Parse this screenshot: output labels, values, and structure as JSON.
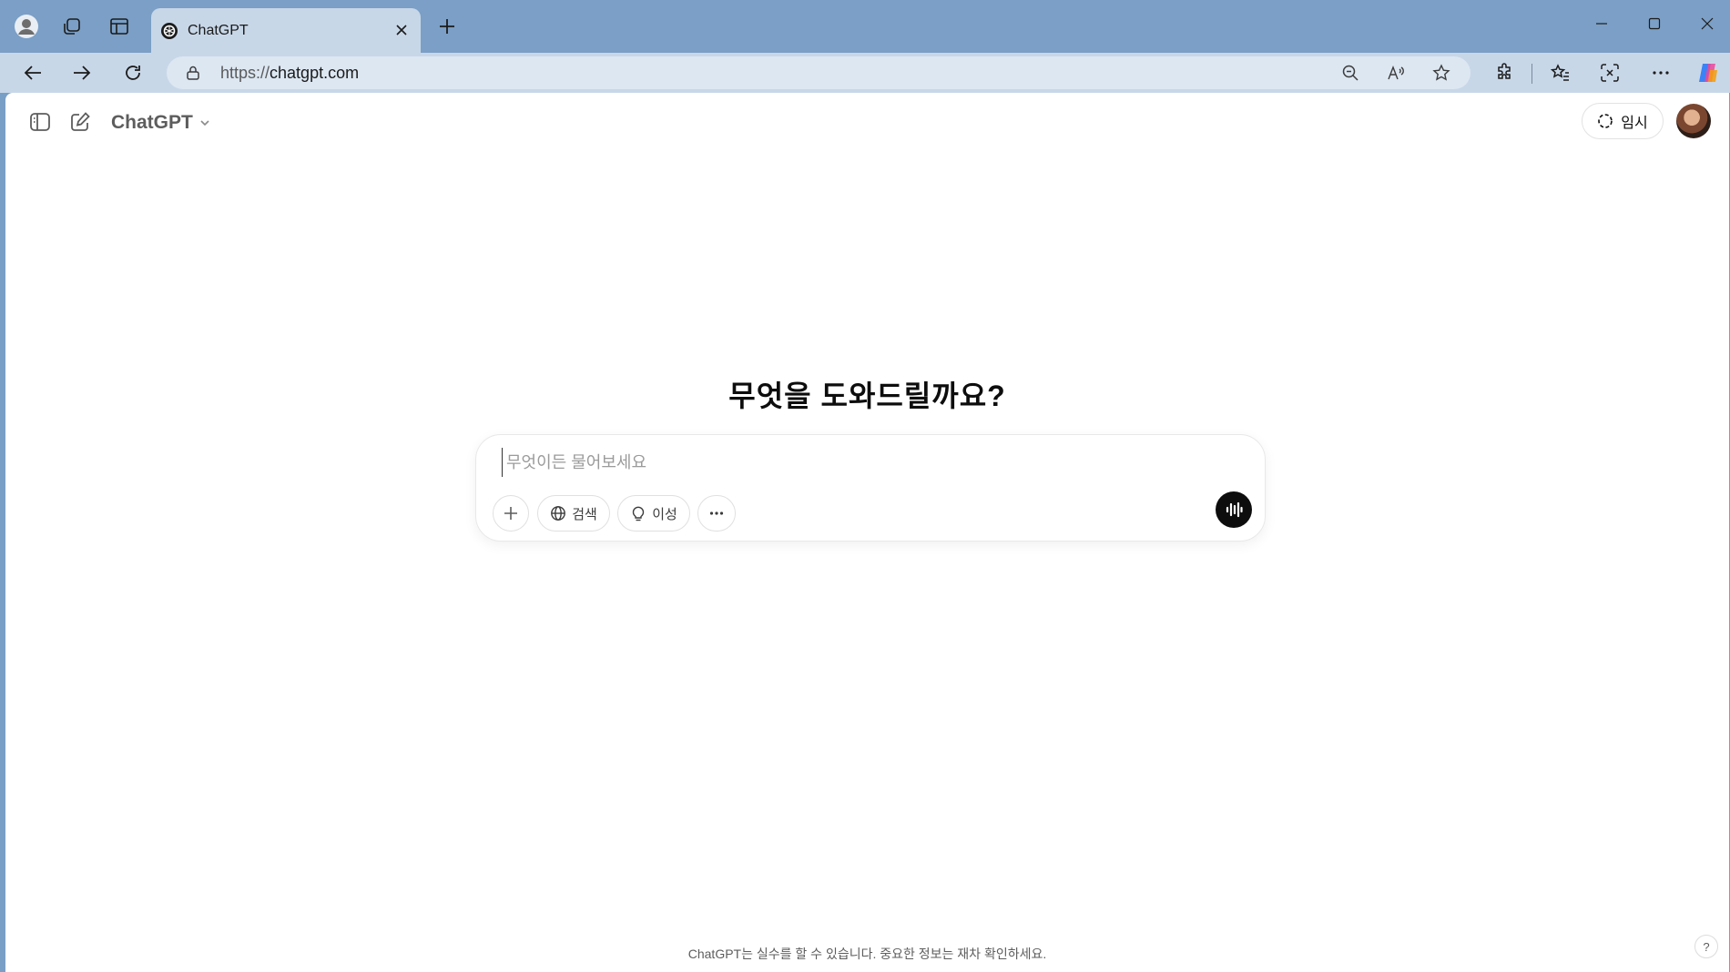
{
  "browser": {
    "tab": {
      "title": "ChatGPT"
    },
    "address": {
      "scheme": "https://",
      "host": "chatgpt.com"
    }
  },
  "header": {
    "model_label": "ChatGPT",
    "temporary_label": "임시"
  },
  "main": {
    "headline": "무엇을 도와드릴까요?",
    "composer": {
      "placeholder": "무엇이든 물어보세요",
      "search_label": "검색",
      "reason_label": "이성"
    }
  },
  "footer": {
    "disclaimer": "ChatGPT는 실수를 할 수 있습니다. 중요한 정보는 재차 확인하세요.",
    "help_label": "?"
  },
  "colors": {
    "titlebar": "#7b9fc6",
    "toolbar": "#c8d7e8",
    "page_bg": "#ffffff",
    "voice_button": "#0d0d0d"
  },
  "icons": [
    "profile-icon",
    "workspaces-icon",
    "tab-actions-icon",
    "chatgpt-logo-icon",
    "close-icon",
    "plus-icon",
    "minimize-icon",
    "maximize-icon",
    "window-close-icon",
    "back-icon",
    "forward-icon",
    "refresh-icon",
    "lock-icon",
    "zoom-out-icon",
    "read-aloud-icon",
    "favorite-star-icon",
    "extensions-icon",
    "favorites-icon",
    "screenshot-icon",
    "more-icon",
    "copilot-icon",
    "sidebar-toggle-icon",
    "new-chat-icon",
    "chevron-down-icon",
    "temporary-chat-icon",
    "globe-icon",
    "lightbulb-icon",
    "voice-icon"
  ]
}
